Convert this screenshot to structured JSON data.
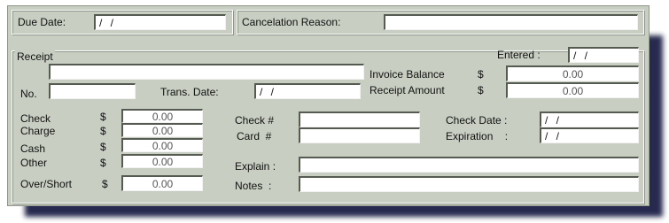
{
  "top": {
    "due_date_label": "Due Date:",
    "due_date_value": "/ /",
    "cancel_reason_label": "Cancelation Reason:",
    "cancel_reason_value": ""
  },
  "receipt": {
    "group_label": "Receipt",
    "entered_label": "Entered :",
    "entered_value": "/ /",
    "receipt_name_value": "",
    "no_label": "No.",
    "no_value": "",
    "trans_date_label": "Trans. Date:",
    "trans_date_value": "/ /",
    "invoice_balance_label": "Invoice Balance",
    "invoice_balance_currency": "$",
    "invoice_balance_value": "0.00",
    "receipt_amount_label": "Receipt Amount",
    "receipt_amount_currency": "$",
    "receipt_amount_value": "0.00",
    "payments": [
      {
        "label": "Check",
        "currency": "$",
        "value": "0.00"
      },
      {
        "label": "Charge",
        "currency": "$",
        "value": "0.00"
      },
      {
        "label": "Cash",
        "currency": "$",
        "value": "0.00"
      },
      {
        "label": "Other",
        "currency": "$",
        "value": "0.00"
      },
      {
        "label": "Over/Short",
        "currency": "$",
        "value": "0.00"
      }
    ],
    "check_no_label": "Check #",
    "check_no_value": "",
    "card_no_label": "Card  #",
    "card_no_value": "",
    "check_date_label": "Check Date :",
    "check_date_value": "/ /",
    "expiration_label": "Expiration    :",
    "expiration_value": "/ /",
    "explain_label": "Explain :",
    "explain_value": "",
    "notes_label": "Notes  :",
    "notes_value": ""
  }
}
